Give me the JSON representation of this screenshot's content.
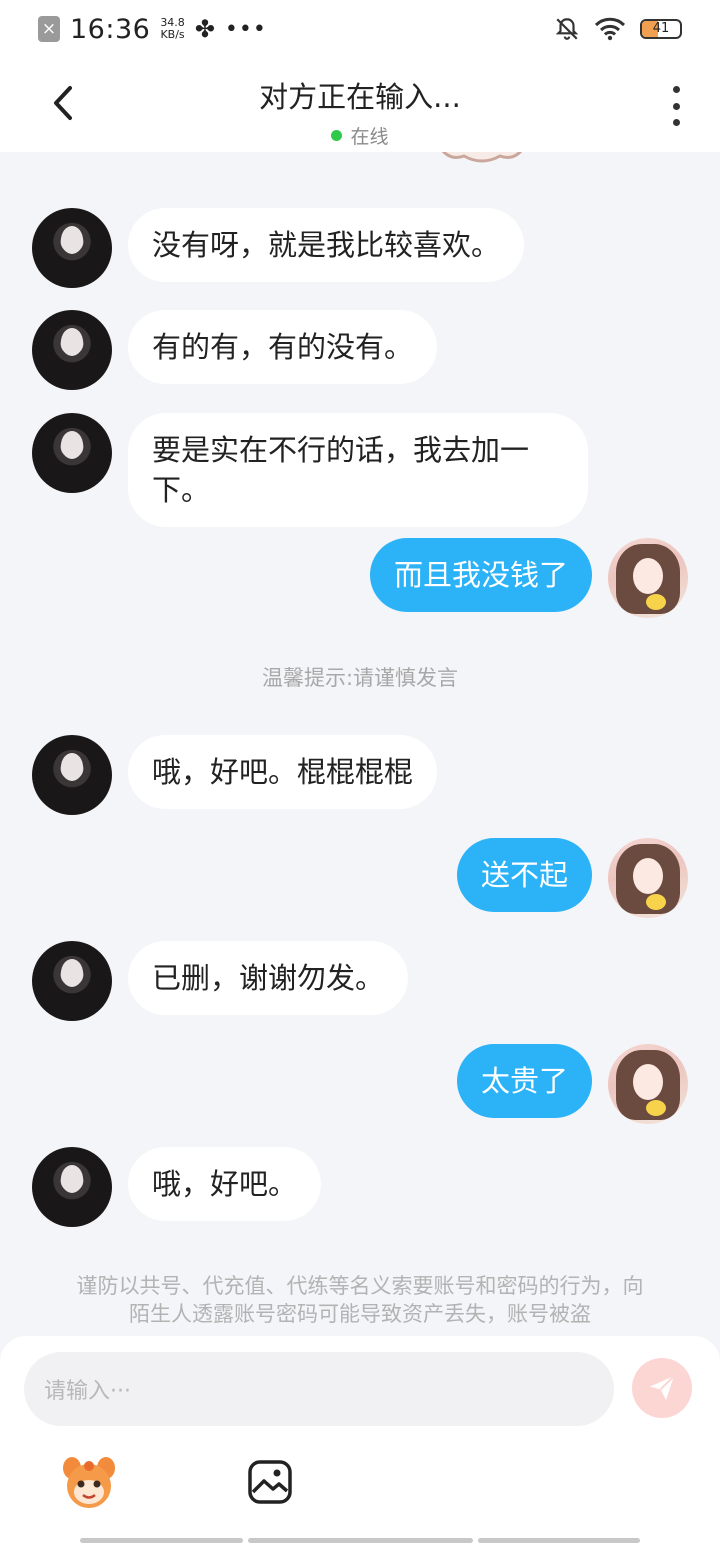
{
  "status_bar": {
    "time": "16:36",
    "speed_value": "34.8",
    "speed_unit": "KB/s",
    "dots": "•••",
    "battery": "41"
  },
  "header": {
    "title": "对方正在输入...",
    "online_status": "在线"
  },
  "messages": [
    {
      "side": "left",
      "text": "没有呀，就是我比较喜欢。"
    },
    {
      "side": "left",
      "text": "有的有，有的没有。"
    },
    {
      "side": "left",
      "text": "要是实在不行的话，我去加一下。"
    },
    {
      "side": "right",
      "text": "而且我没钱了"
    },
    {
      "side": "left",
      "text": "哦，好吧。棍棍棍棍"
    },
    {
      "side": "right",
      "text": "送不起"
    },
    {
      "side": "left",
      "text": "已删，谢谢勿发。"
    },
    {
      "side": "right",
      "text": "太贵了"
    },
    {
      "side": "left",
      "text": "哦，好吧。"
    }
  ],
  "tip": "温馨提示:请谨慎发言",
  "warning": "谨防以共号、代充值、代练等名义索要账号和密码的行为，向陌生人透露账号密码可能导致资产丢失，账号被盗",
  "composer": {
    "placeholder": "请输入···"
  },
  "colors": {
    "accent": "#2bb2f7",
    "online": "#2fc94b",
    "send_disabled": "#fcd6d2"
  }
}
